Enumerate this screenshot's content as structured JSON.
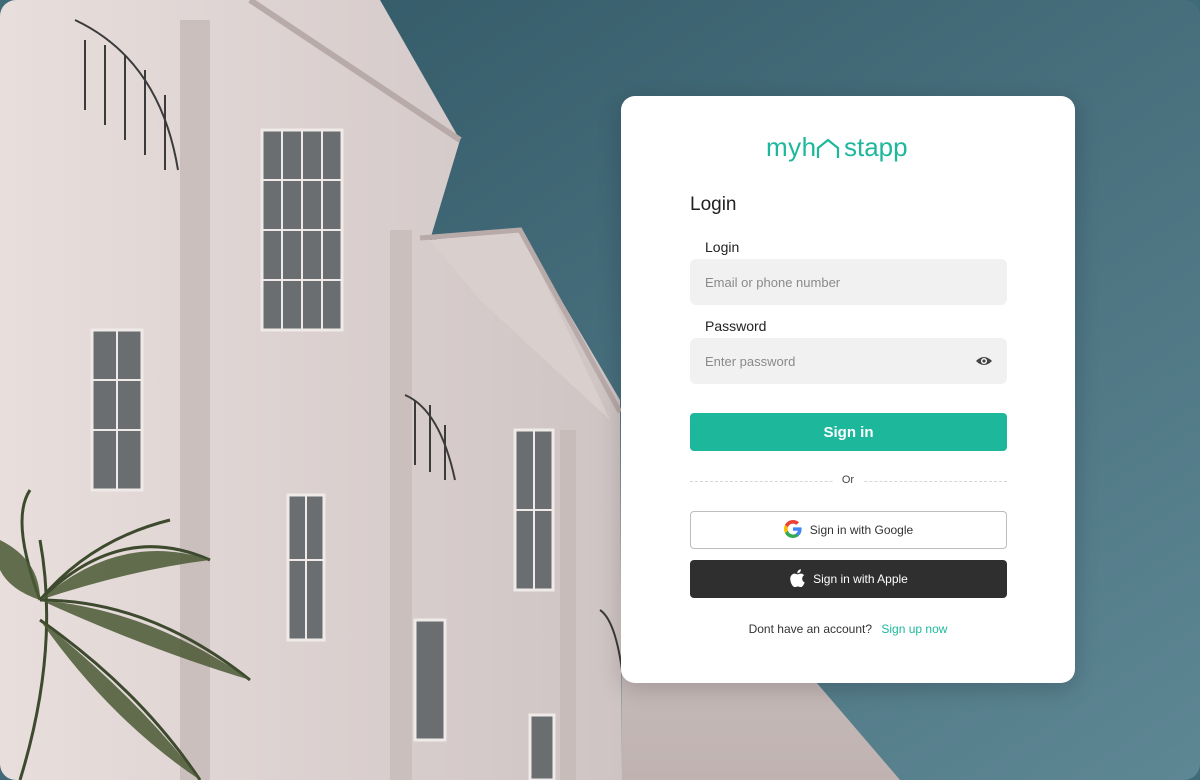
{
  "brand": {
    "name": "myhostapp",
    "logo_text_left": "myh",
    "logo_text_right": "stapp",
    "accent_color": "#1db89c",
    "dark_color": "#2f2f2f"
  },
  "form": {
    "title": "Login",
    "login_label": "Login",
    "login_placeholder": "Email or phone number",
    "password_label": "Password",
    "password_placeholder": "Enter password",
    "password_toggle_icon": "eye-icon"
  },
  "actions": {
    "signin_label": "Sign in",
    "divider_text": "Or",
    "google_label": "Sign in with Google",
    "apple_label": "Sign in with Apple"
  },
  "footer": {
    "question": "Dont have an account?",
    "signup_link": "Sign up now"
  }
}
